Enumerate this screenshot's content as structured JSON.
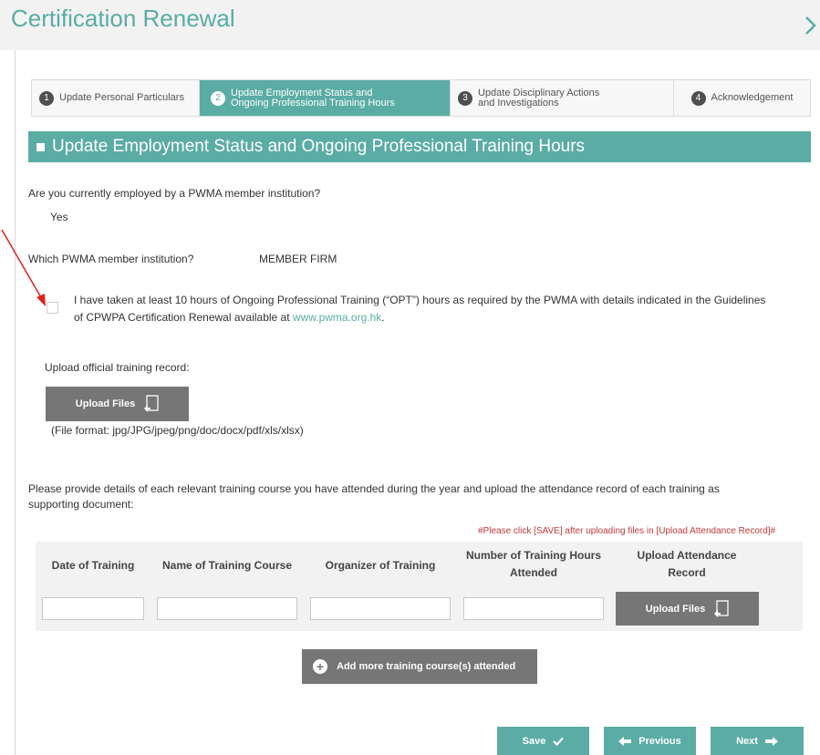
{
  "page": {
    "title": "Certification Renewal"
  },
  "stepper": {
    "steps": [
      {
        "num": "1",
        "label": "Update Personal Particulars"
      },
      {
        "num": "2",
        "label_line1": "Update Employment Status and",
        "label_line2": "Ongoing Professional Training Hours"
      },
      {
        "num": "3",
        "label_line1": "Update Disciplinary Actions",
        "label_line2": "and Investigations"
      },
      {
        "num": "4",
        "label": "Acknowledgement"
      }
    ]
  },
  "section": {
    "title": "Update Employment Status and Ongoing Professional Training Hours"
  },
  "employment": {
    "question": "Are you currently employed by a PWMA member institution?",
    "answer": "Yes",
    "institution_label": "Which PWMA member institution?",
    "institution_value": "MEMBER FIRM"
  },
  "opt": {
    "text_line1": "I have taken at least 10 hours of Ongoing Professional Training (“OPT”) hours as required by the PWMA with details indicated in the Guidelines",
    "text_line2_prefix": "of CPWPA Certification Renewal available at",
    "link": "www.pwma.org.hk",
    "text_line2_suffix": "."
  },
  "upload": {
    "label": "Upload official training record:",
    "button_label": "Upload Files",
    "format_note": "(File format: jpg/JPG/jpeg/png/doc/docx/pdf/xls/xlsx)"
  },
  "courses": {
    "instruction_line1": "Please provide details of each relevant training course you have attended during the year and upload the attendance record of each training as",
    "instruction_line2": "supporting document:",
    "save_hint": "#Please click [SAVE] after uploading files in [Upload Attendance Record]#",
    "headers": {
      "date": "Date of Training",
      "name": "Name of Training Course",
      "organizer": "Organizer of Training",
      "hours_line1": "Number of Training Hours",
      "hours_line2": "Attended",
      "upload_line1": "Upload Attendance",
      "upload_line2": "Record"
    },
    "row_upload_label": "Upload Files",
    "add_more_label": "Add more training course(s) attended"
  },
  "nav": {
    "save": "Save",
    "previous": "Previous",
    "next": "Next"
  },
  "colors": {
    "accent": "#5aaca4",
    "button_gray": "#767676",
    "warning_red": "#c0393b"
  }
}
